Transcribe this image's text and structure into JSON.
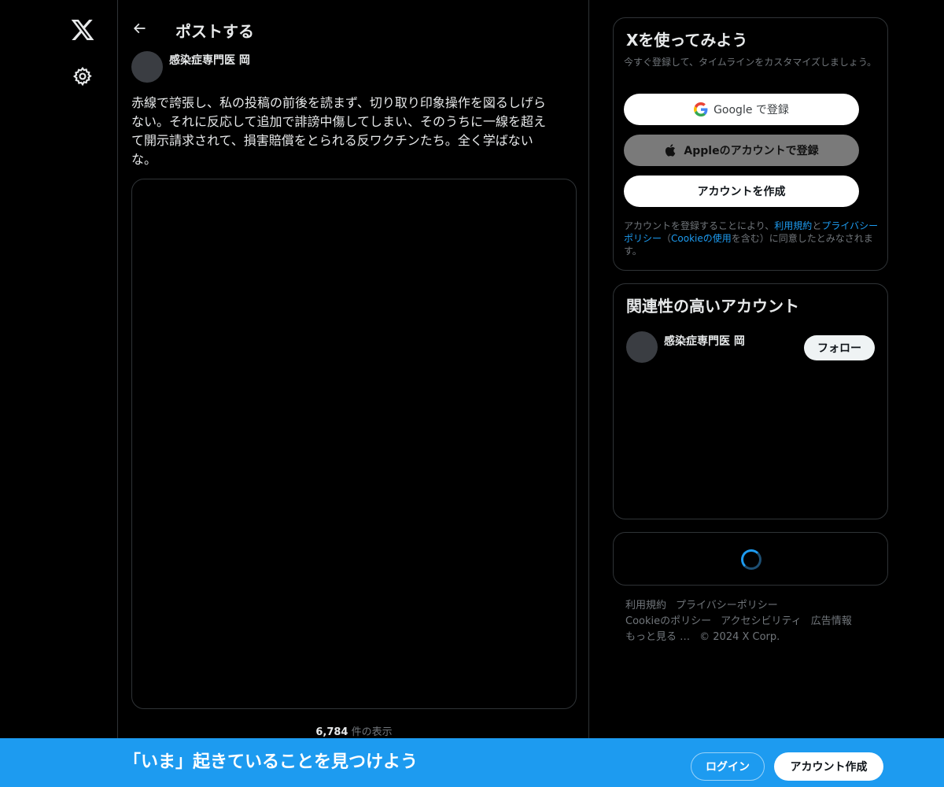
{
  "nav": {
    "logo_icon": "x-logo-icon",
    "settings_icon": "gear-icon"
  },
  "header": {
    "back_icon": "back-arrow-icon",
    "title": "ポストする"
  },
  "post": {
    "author": "感染症専門医 岡",
    "text_lines": [
      "赤線で誇張し、私の投稿の前後を読まず、切り取り印象操作を図るしげら",
      "ない。それに反応して追加で誹謗中傷してしまい、そのうちに一線を超え",
      "て開示請求されて、損害賠償をとられる反ワクチンたち。全く学ばない",
      "な。"
    ],
    "views_count": "6,784",
    "views_label": " 件の表示"
  },
  "signup_card": {
    "title": "Xを使ってみよう",
    "subtitle": "今すぐ登録して、タイムラインをカスタマイズしましょう。",
    "google_label": "Google で登録",
    "apple_label": "Appleのアカウントで登録",
    "create_label": "アカウントを作成",
    "terms_prefix": "アカウントを登録することにより、",
    "terms_link": "利用規約",
    "terms_and": "と",
    "privacy_link": "プライバシーポリシー",
    "paren_open": "（",
    "cookie_link": "Cookieの使用",
    "terms_suffix": "を含む）に同意したとみなされます。"
  },
  "related_card": {
    "title": "関連性の高いアカウント",
    "account_name": "感染症専門医 岡",
    "follow_label": "フォロー"
  },
  "footer": {
    "links": [
      "利用規約",
      "プライバシーポリシー",
      "Cookieのポリシー",
      "アクセシビリティ",
      "広告情報",
      "もっと見る …",
      "© 2024 X Corp."
    ]
  },
  "bottom_bar": {
    "text": "「いま」起きていることを見つけよう",
    "login_label": "ログイン",
    "signup_label": "アカウント作成"
  },
  "colors": {
    "accent": "#1d9bf0",
    "background": "#000000",
    "border": "#2f3336",
    "muted_text": "#71767b"
  }
}
